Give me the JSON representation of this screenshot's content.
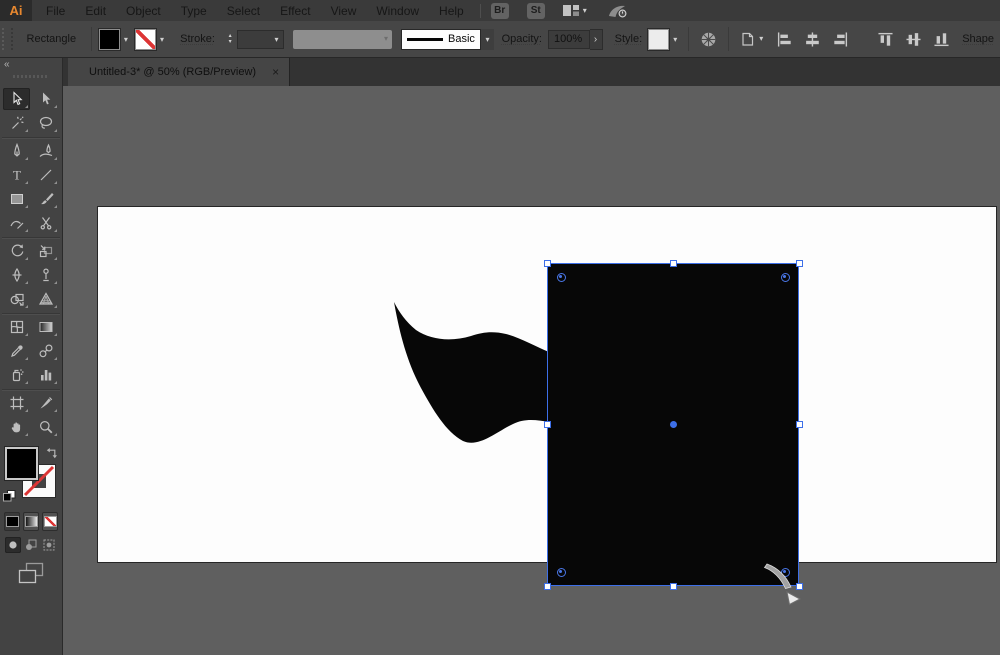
{
  "menubar": {
    "logo": "Ai",
    "items": [
      "File",
      "Edit",
      "Object",
      "Type",
      "Select",
      "Effect",
      "View",
      "Window",
      "Help"
    ],
    "bridge_label": "Br",
    "stock_label": "St"
  },
  "controlbar": {
    "selection_type": "Rectangle",
    "stroke_label": "Stroke:",
    "style_name": "Basic",
    "opacity_label": "Opacity:",
    "opacity_value": "100%",
    "style_label": "Style:",
    "shape_link": "Shape"
  },
  "tab": {
    "title": "Untitled-3* @ 50% (RGB/Preview)",
    "close": "×"
  },
  "toolbar": {
    "collapse": "«",
    "tools": [
      "selection",
      "direct-selection",
      "magic-wand",
      "lasso",
      "pen",
      "curvature",
      "type",
      "line-segment",
      "rectangle",
      "paintbrush",
      "shaper",
      "scissors",
      "rotate",
      "scale",
      "width",
      "puppet-warp",
      "shape-builder",
      "perspective-grid",
      "mesh",
      "gradient",
      "eyedropper",
      "blend",
      "symbol-sprayer",
      "column-graph",
      "artboard",
      "slice",
      "hand",
      "zoom"
    ]
  },
  "icons": {
    "chevron_down": "▾",
    "step_up": "▴",
    "step_down": "▾",
    "arrow_next": "›",
    "type_glyph": "T"
  },
  "colors": {
    "selection_blue": "#3d6fe8",
    "logo_orange": "#e8882f",
    "none_red": "#dd3535",
    "panel_gray": "#464646",
    "canvas_gray": "#5f5f5f",
    "artboard_white": "#fdfdfd",
    "shape_black": "#070707"
  }
}
